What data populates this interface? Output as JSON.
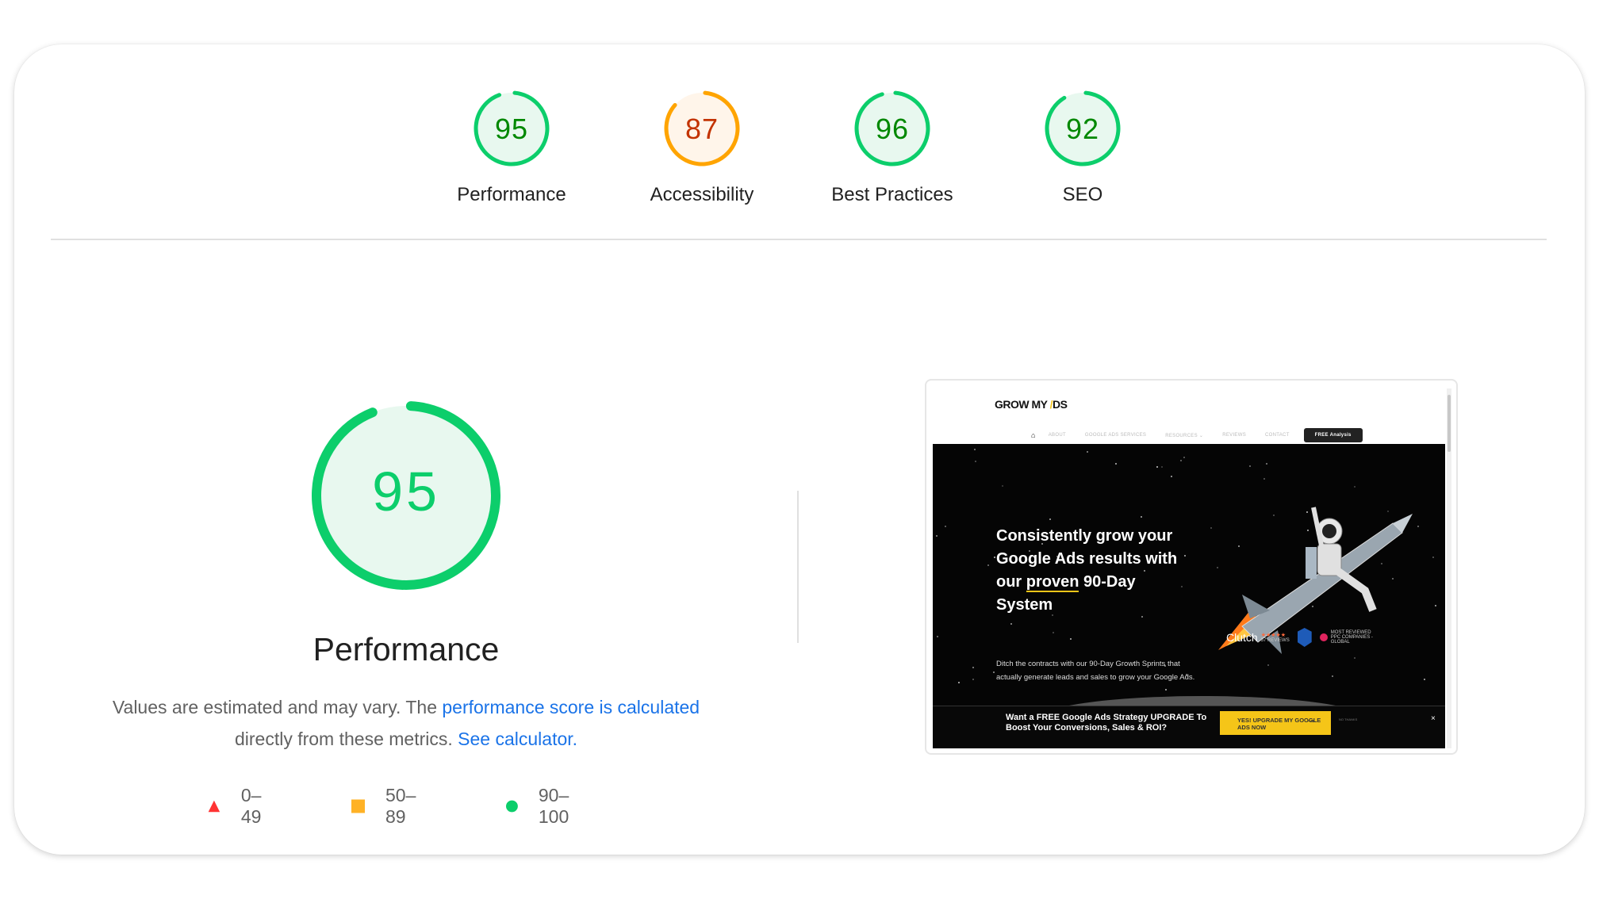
{
  "colors": {
    "pass": "#0cce6b",
    "pass_text": "#008800",
    "pass_bg": "#e8f8ef",
    "average": "#ffa400",
    "average_text": "#c33300",
    "average_bg": "#fff5ea",
    "fail": "#ff3333",
    "link": "#1a73e8"
  },
  "categories": [
    {
      "label": "Performance",
      "score": 95,
      "rating": "pass"
    },
    {
      "label": "Accessibility",
      "score": 87,
      "rating": "average"
    },
    {
      "label": "Best Practices",
      "score": 96,
      "rating": "pass"
    },
    {
      "label": "SEO",
      "score": 92,
      "rating": "pass"
    }
  ],
  "performance": {
    "score": 95,
    "title": "Performance",
    "description_prefix": "Values are estimated and may vary. The ",
    "description_link": "performance score is calculated",
    "description_middle": " directly from these metrics. ",
    "calculator_link": "See calculator."
  },
  "legend": [
    {
      "shape": "triangle-icon",
      "range": "0–49"
    },
    {
      "shape": "square-icon",
      "range": "50–89"
    },
    {
      "shape": "circle-icon",
      "range": "90–100"
    }
  ],
  "screenshot": {
    "logo": "GROW MY ",
    "logo_slash": "/",
    "logo_tail": "DS",
    "nav": [
      "ABOUT",
      "GOOGLE ADS SERVICES",
      "RESOURCES ⌄",
      "REVIEWS",
      "CONTACT"
    ],
    "nav_cta": "FREE Analysis",
    "hero_title_1": "Consistently grow your Google Ads results with our ",
    "hero_title_underline": "proven",
    "hero_title_2": " 90-Day System",
    "hero_sub": "Ditch the contracts with our 90-Day Growth Sprints that actually generate leads and sales to grow your Google Ads.",
    "badge_clutch": "Clutch",
    "badge_stars": "★★★★★",
    "badge_reviews": "57 REVIEWS",
    "badge_ppc": "MOST REVIEWED PPC COMPANIES - GLOBAL",
    "cta_text": "Want a FREE Google Ads Strategy UPGRADE To Boost Your Conversions, Sales & ROI?",
    "cta_button": "YES! UPGRADE MY GOOGLE ADS NOW",
    "cta_no": "NO THANKS",
    "cta_close": "×"
  }
}
